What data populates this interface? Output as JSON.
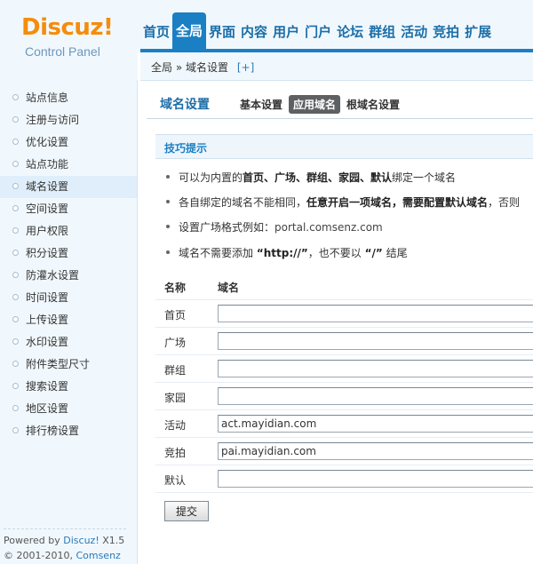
{
  "logo": {
    "text": "Discuz!",
    "subtitle": "Control Panel"
  },
  "nav": [
    {
      "label": "首页"
    },
    {
      "label": "全局",
      "active": true
    },
    {
      "label": "界面"
    },
    {
      "label": "内容"
    },
    {
      "label": "用户"
    },
    {
      "label": "门户"
    },
    {
      "label": "论坛"
    },
    {
      "label": "群组"
    },
    {
      "label": "活动"
    },
    {
      "label": "竞拍"
    },
    {
      "label": "扩展"
    }
  ],
  "breadcrumb": {
    "root": "全局",
    "separator": "»",
    "current": "域名设置",
    "add": "[+]"
  },
  "sidebar": {
    "items": [
      {
        "label": "站点信息"
      },
      {
        "label": "注册与访问"
      },
      {
        "label": "优化设置"
      },
      {
        "label": "站点功能"
      },
      {
        "label": "域名设置",
        "active": true
      },
      {
        "label": "空间设置"
      },
      {
        "label": "用户权限"
      },
      {
        "label": "积分设置"
      },
      {
        "label": "防灌水设置"
      },
      {
        "label": "时间设置"
      },
      {
        "label": "上传设置"
      },
      {
        "label": "水印设置"
      },
      {
        "label": "附件类型尺寸"
      },
      {
        "label": "搜索设置"
      },
      {
        "label": "地区设置"
      },
      {
        "label": "排行榜设置"
      }
    ]
  },
  "footer": {
    "powered_prefix": "Powered by",
    "powered_link": "Discuz!",
    "version": "X1.5",
    "copyright_prefix": "© 2001-2010,",
    "copyright_link": "Comsenz Inc."
  },
  "content": {
    "title": "域名设置",
    "tabs": [
      {
        "label": "基本设置"
      },
      {
        "label": "应用域名",
        "active": true
      },
      {
        "label": "根域名设置"
      }
    ],
    "tips_title": "技巧提示",
    "tips": {
      "t1_prefix": "可以为内置的",
      "t1_bold": "首页、广场、群组、家园、默认",
      "t1_suffix": "绑定一个域名",
      "t2_prefix": "各自绑定的域名不能相同，",
      "t2_bold": "任意开启一项域名，需要配置默认域名",
      "t2_suffix": "，否则",
      "t3_prefix": "设置广场格式例如：",
      "t3_example": "portal.comsenz.com",
      "t4_prefix": "域名不需要添加",
      "t4_bold1": "“http://”",
      "t4_middle": "，也不要以",
      "t4_bold2": "“/”",
      "t4_suffix": "结尾"
    },
    "table": {
      "col_name": "名称",
      "col_domain": "域名",
      "rows": [
        {
          "label": "首页",
          "value": ""
        },
        {
          "label": "广场",
          "value": ""
        },
        {
          "label": "群组",
          "value": ""
        },
        {
          "label": "家园",
          "value": ""
        },
        {
          "label": "活动",
          "value": "act.mayidian.com"
        },
        {
          "label": "竞拍",
          "value": "pai.mayidian.com"
        },
        {
          "label": "默认",
          "value": ""
        }
      ]
    },
    "submit_label": "提交"
  }
}
